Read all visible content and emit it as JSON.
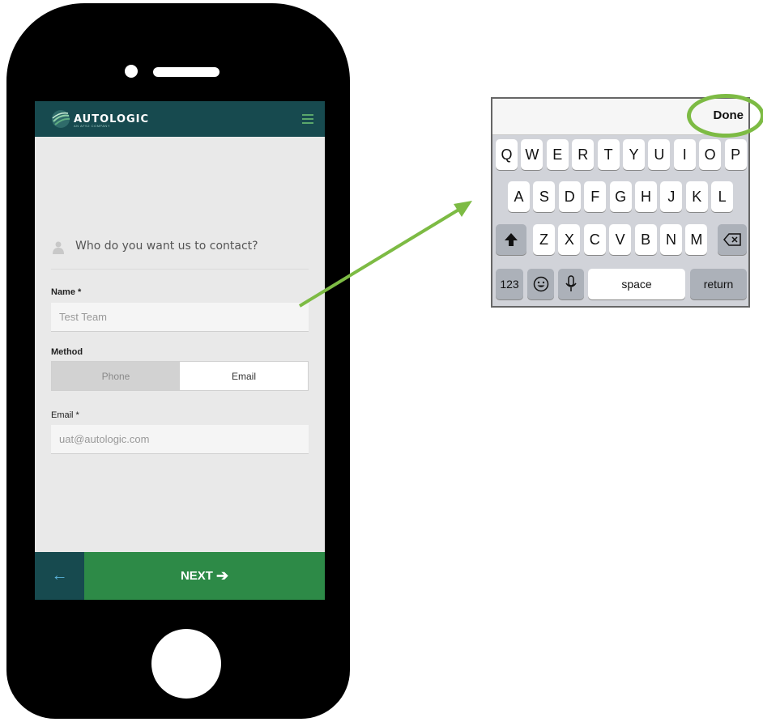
{
  "app": {
    "brand": "AUTOLOGIC",
    "brand_sub": "AN AFS2 COMPANY",
    "menu_icon": "hamburger-icon"
  },
  "form": {
    "prompt": "Who do you want us to contact?",
    "name_label": "Name *",
    "name_value": "Test Team",
    "method_label": "Method",
    "method_options": [
      "Phone",
      "Email"
    ],
    "method_selected": "Email",
    "email_label": "Email *",
    "email_value": "uat@autologic.com"
  },
  "nav": {
    "back_icon": "arrow-left-icon",
    "next_label": "NEXT",
    "next_icon": "arrow-right-icon"
  },
  "keyboard": {
    "done_label": "Done",
    "row1": [
      "Q",
      "W",
      "E",
      "R",
      "T",
      "Y",
      "U",
      "I",
      "O",
      "P"
    ],
    "row2": [
      "A",
      "S",
      "D",
      "F",
      "G",
      "H",
      "J",
      "K",
      "L"
    ],
    "row3": [
      "Z",
      "X",
      "C",
      "V",
      "B",
      "N",
      "M"
    ],
    "numbers_label": "123",
    "space_label": "space",
    "return_label": "return"
  },
  "colors": {
    "appbar": "#174a4f",
    "next_green": "#2d8a47",
    "callout_green": "#7dbb44"
  }
}
